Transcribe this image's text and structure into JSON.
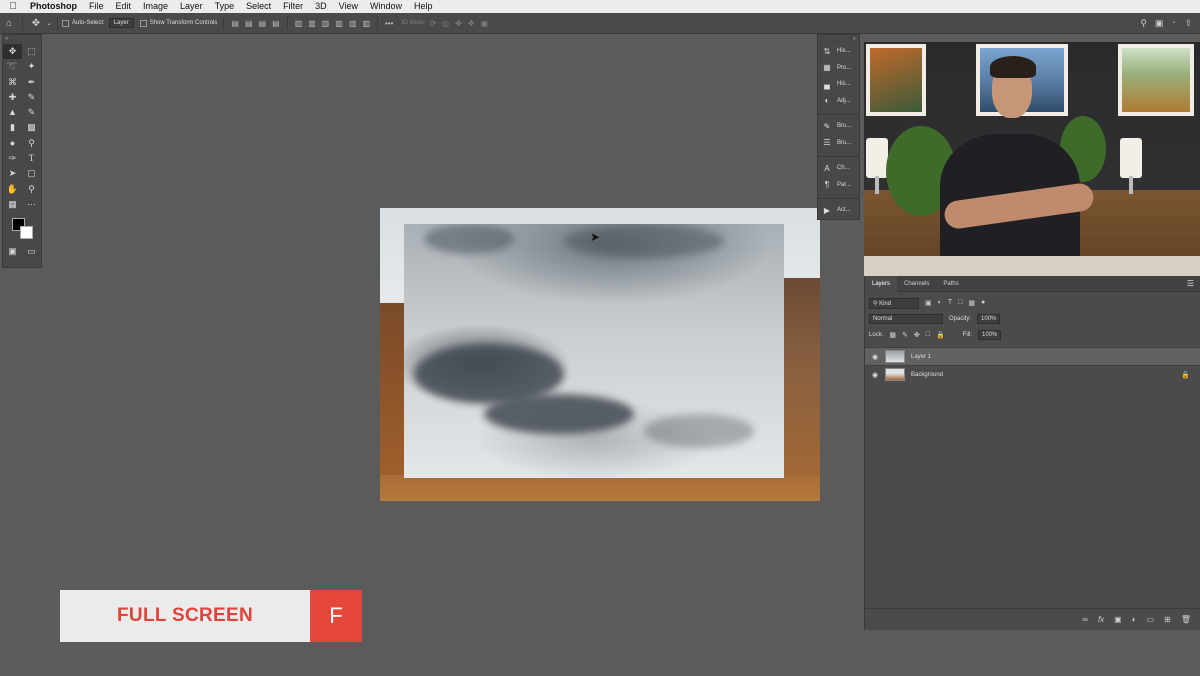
{
  "menubar": {
    "app_name": "Photoshop",
    "items": [
      "File",
      "Edit",
      "Image",
      "Layer",
      "Type",
      "Select",
      "Filter",
      "3D",
      "View",
      "Window",
      "Help"
    ]
  },
  "options_bar": {
    "auto_select_label": "Auto-Select:",
    "auto_select_value": "Layer",
    "transform_label": "Show Transform Controls",
    "mode_3d": "3D Mode:"
  },
  "dock": {
    "items": [
      "His...",
      "Pro...",
      "His...",
      "Adj...",
      "Bru...",
      "Bru...",
      "Ch...",
      "Par...",
      "Act..."
    ]
  },
  "layers_panel": {
    "tabs": [
      "Layers",
      "Channels",
      "Paths"
    ],
    "filter_kind": "Kind",
    "blend_mode": "Normal",
    "opacity_label": "Opacity:",
    "opacity_value": "100%",
    "lock_label": "Lock:",
    "fill_label": "Fill:",
    "fill_value": "100%",
    "layers": [
      {
        "name": "Layer 1",
        "selected": true
      },
      {
        "name": "Background",
        "selected": false,
        "locked": true
      }
    ]
  },
  "overlay": {
    "label": "FULL SCREEN",
    "key": "F",
    "colors": {
      "label_text": "#e0433a",
      "key_bg": "#e5473d"
    }
  }
}
